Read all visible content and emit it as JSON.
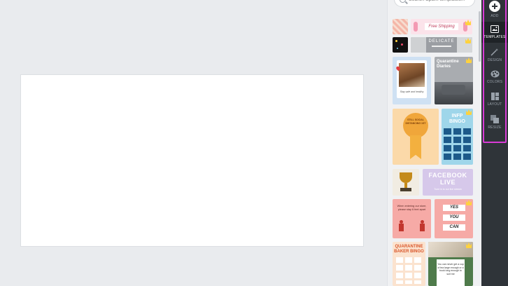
{
  "search": {
    "placeholder": "Search Spark templates..."
  },
  "rail": {
    "items": [
      {
        "key": "add",
        "label": "ADD",
        "icon": "add-icon"
      },
      {
        "key": "templates",
        "label": "TEMPLATES",
        "icon": "templates-icon",
        "active": true
      },
      {
        "key": "design",
        "label": "DESIGN",
        "icon": "magic-wand-icon"
      },
      {
        "key": "colors",
        "label": "COLORS",
        "icon": "palette-icon"
      },
      {
        "key": "layout",
        "label": "LAYOUT",
        "icon": "layout-icon"
      },
      {
        "key": "resize",
        "label": "RESIZE",
        "icon": "resize-icon"
      }
    ]
  },
  "templates": {
    "free_shipping": "Free Shipping",
    "delicate": "DELICATE",
    "quarantine_diaries": "Quarantine Diaries",
    "dog_caption": "Stay safe and healthy",
    "still_social": "STILL SOCIAL DISTANCING 1ST",
    "infp": "INFP",
    "bingo": "BINGO",
    "facebook": "FACEBOOK",
    "live": "LIVE",
    "facebook_sub": "Tune in to our live stream",
    "when_entering": "When entering our store, please stay 6 feet apart",
    "yes": "YES",
    "you": "YOU",
    "can": "CAN",
    "quarantine": "QUARANTINE",
    "baker_bingo": "BAKER BINGO",
    "quote": "You can never get a cup of tea large enough or a book long enough to suit me"
  },
  "colors": {
    "accent": "#d93bd6",
    "rail": "#2f3439"
  }
}
